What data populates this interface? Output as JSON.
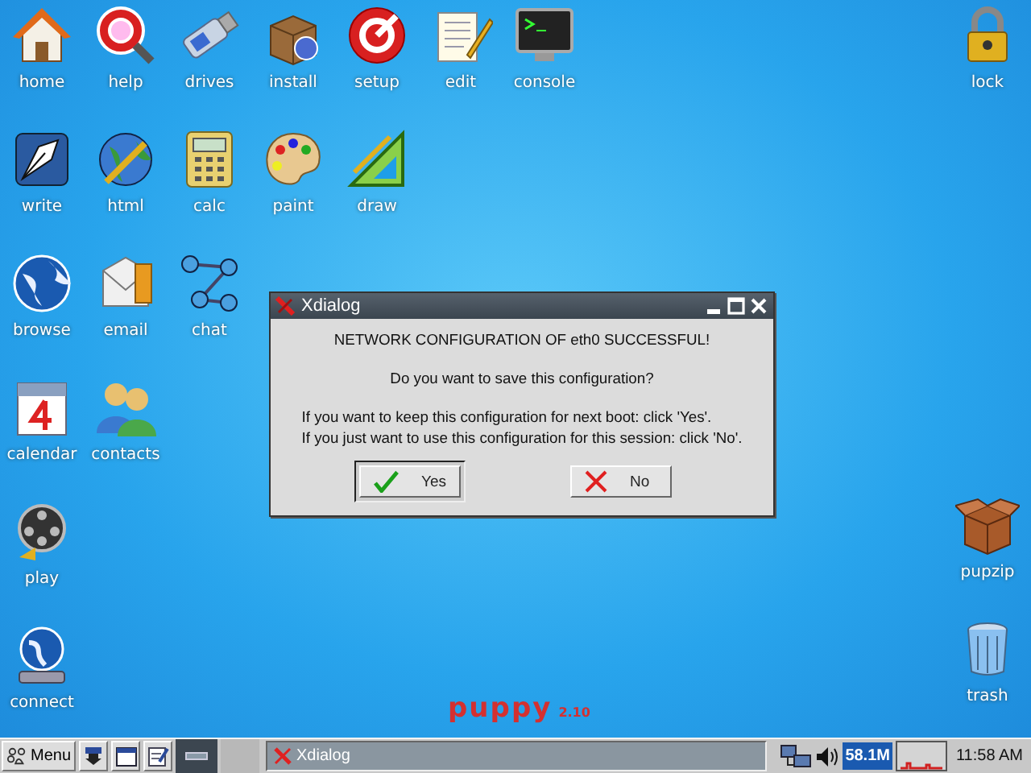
{
  "desktop": {
    "left_rows": [
      [
        {
          "kind": "home",
          "label": "home"
        },
        {
          "kind": "help",
          "label": "help"
        },
        {
          "kind": "drives",
          "label": "drives"
        },
        {
          "kind": "install",
          "label": "install"
        },
        {
          "kind": "setup",
          "label": "setup"
        },
        {
          "kind": "edit",
          "label": "edit"
        },
        {
          "kind": "console",
          "label": "console"
        }
      ],
      [
        {
          "kind": "write",
          "label": "write"
        },
        {
          "kind": "html",
          "label": "html"
        },
        {
          "kind": "calc",
          "label": "calc"
        },
        {
          "kind": "paint",
          "label": "paint"
        },
        {
          "kind": "draw",
          "label": "draw"
        }
      ],
      [
        {
          "kind": "browse",
          "label": "browse"
        },
        {
          "kind": "email",
          "label": "email"
        },
        {
          "kind": "chat",
          "label": "chat"
        }
      ],
      [
        {
          "kind": "calendar",
          "label": "calendar"
        },
        {
          "kind": "contacts",
          "label": "contacts"
        }
      ],
      [
        {
          "kind": "play",
          "label": "play"
        }
      ],
      [
        {
          "kind": "connect",
          "label": "connect"
        }
      ]
    ],
    "right_top": [
      {
        "kind": "lock",
        "label": "lock"
      }
    ],
    "right_bottom": [
      {
        "kind": "pupzip",
        "label": "pupzip"
      },
      {
        "kind": "trash",
        "label": "trash"
      }
    ],
    "logo": {
      "name": "puppy",
      "version": "2.10"
    }
  },
  "dialog": {
    "title": "Xdialog",
    "heading": "NETWORK CONFIGURATION OF eth0 SUCCESSFUL!",
    "question": "Do you want to save this configuration?",
    "lines": [
      "If you want to keep this configuration for next boot: click 'Yes'.",
      "If you just want to use this configuration for this session: click 'No'."
    ],
    "buttons": [
      {
        "kind": "yes",
        "label": "Yes",
        "focused": true
      },
      {
        "kind": "no",
        "label": "No",
        "focused": false
      }
    ]
  },
  "taskbar": {
    "menu_label": "Menu",
    "tasks": [
      {
        "title": "Xdialog",
        "selected": false
      }
    ],
    "memory": "58.1M",
    "clock": "11:58 AM"
  }
}
